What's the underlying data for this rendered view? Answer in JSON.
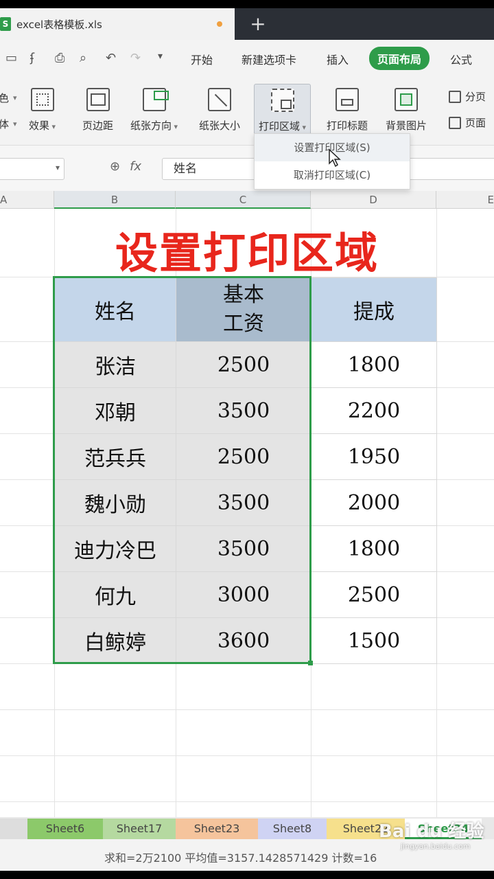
{
  "window": {
    "file_name": "excel表格模板.xls",
    "file_icon": "S",
    "new_tab": "+"
  },
  "menu": {
    "items": [
      "开始",
      "新建选项卡",
      "插入",
      "页面布局",
      "公式"
    ],
    "active": "页面布局"
  },
  "ribbon": {
    "left_partial": [
      "色",
      "体"
    ],
    "effect": "效果",
    "margins": "页边距",
    "orientation": "纸张方向",
    "size": "纸张大小",
    "print_area": "打印区域",
    "print_titles": "打印标题",
    "background": "背景图片",
    "page_break": "分页",
    "page_setup": "页面"
  },
  "formula_bar": {
    "value": "姓名",
    "fx": "fx"
  },
  "dropdown": {
    "items": [
      "设置打印区域(S)",
      "取消打印区域(C)"
    ],
    "hovered": 0
  },
  "columns": [
    "A",
    "B",
    "C",
    "D",
    "E"
  ],
  "sheet": {
    "title": "设置打印区域",
    "headers": [
      "姓名",
      "基本工资",
      "提成"
    ],
    "rows": [
      [
        "张洁",
        "2500",
        "1800"
      ],
      [
        "邓朝",
        "3500",
        "2200"
      ],
      [
        "范兵兵",
        "2500",
        "1950"
      ],
      [
        "魏小勋",
        "3500",
        "2000"
      ],
      [
        "迪力冷巴",
        "3500",
        "1800"
      ],
      [
        "何九",
        "3000",
        "2500"
      ],
      [
        "白鲸婷",
        "3600",
        "1500"
      ]
    ]
  },
  "sheet_tabs": [
    {
      "label": "Sheet6",
      "color": "#8cc96a"
    },
    {
      "label": "Sheet17",
      "color": "#b5d9a0"
    },
    {
      "label": "Sheet23",
      "color": "#f5c49c"
    },
    {
      "label": "Sheet8",
      "color": "#cfd3f3"
    },
    {
      "label": "Sheet22",
      "color": "#f6e08c"
    },
    {
      "label": "Sheet24",
      "color": "#ffffff"
    }
  ],
  "active_sheet": "Sheet24",
  "status": {
    "text": "求和=2万2100  平均值=3157.1428571429  计数=16"
  },
  "watermark": {
    "text": "Bai du 经验",
    "sub": "jingyan.baidu.com"
  },
  "colors": {
    "accent": "#2e9c4a",
    "title_red": "#e8261c",
    "header_blue": "#c4d6ea"
  }
}
